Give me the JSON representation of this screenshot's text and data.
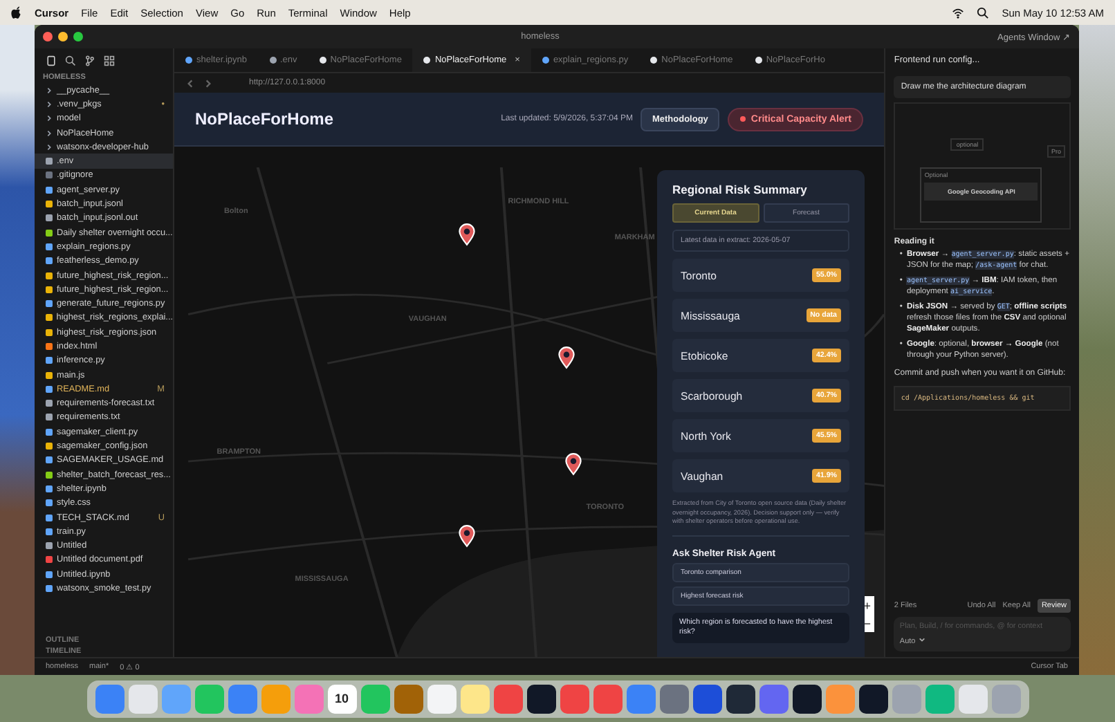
{
  "menu_bar": {
    "app": "Cursor",
    "items": [
      "File",
      "Edit",
      "Selection",
      "View",
      "Go",
      "Run",
      "Terminal",
      "Window",
      "Help"
    ],
    "clock": "Sun May 10  12:53 AM"
  },
  "window": {
    "title": "homeless",
    "agents_label": "Agents Window ↗"
  },
  "explorer": {
    "root": "HOMELESS",
    "items": [
      {
        "name": "__pycache__",
        "kind": "folder",
        "selected": false
      },
      {
        "name": ".venv_pkgs",
        "kind": "folder",
        "selected": false,
        "badge": "•"
      },
      {
        "name": "model",
        "kind": "folder",
        "selected": false
      },
      {
        "name": "NoPlaceHome",
        "kind": "folder",
        "selected": false
      },
      {
        "name": "watsonx-developer-hub",
        "kind": "folder",
        "selected": false
      },
      {
        "name": ".env",
        "kind": "env",
        "selected": true
      },
      {
        "name": ".gitignore",
        "kind": "git",
        "selected": false
      },
      {
        "name": "agent_server.py",
        "kind": "py",
        "selected": false
      },
      {
        "name": "batch_input.jsonl",
        "kind": "json",
        "selected": false
      },
      {
        "name": "batch_input.jsonl.out",
        "kind": "txt",
        "selected": false
      },
      {
        "name": "Daily shelter overnight occu...",
        "kind": "csv",
        "selected": false
      },
      {
        "name": "explain_regions.py",
        "kind": "py",
        "selected": false
      },
      {
        "name": "featherless_demo.py",
        "kind": "py",
        "selected": false
      },
      {
        "name": "future_highest_risk_region...",
        "kind": "json",
        "selected": false
      },
      {
        "name": "future_highest_risk_region...",
        "kind": "json",
        "selected": false
      },
      {
        "name": "generate_future_regions.py",
        "kind": "py",
        "selected": false
      },
      {
        "name": "highest_risk_regions_explai...",
        "kind": "json",
        "selected": false
      },
      {
        "name": "highest_risk_regions.json",
        "kind": "json",
        "selected": false
      },
      {
        "name": "index.html",
        "kind": "html",
        "selected": false
      },
      {
        "name": "inference.py",
        "kind": "py",
        "selected": false
      },
      {
        "name": "main.js",
        "kind": "js",
        "selected": false
      },
      {
        "name": "README.md",
        "kind": "md",
        "selected": false,
        "badge": "M"
      },
      {
        "name": "requirements-forecast.txt",
        "kind": "txt",
        "selected": false
      },
      {
        "name": "requirements.txt",
        "kind": "txt",
        "selected": false
      },
      {
        "name": "sagemaker_client.py",
        "kind": "py",
        "selected": false
      },
      {
        "name": "sagemaker_config.json",
        "kind": "json",
        "selected": false
      },
      {
        "name": "SAGEMAKER_USAGE.md",
        "kind": "md",
        "selected": false
      },
      {
        "name": "shelter_batch_forecast_res...",
        "kind": "csv",
        "selected": false
      },
      {
        "name": "shelter.ipynb",
        "kind": "ipynb",
        "selected": false
      },
      {
        "name": "style.css",
        "kind": "css",
        "selected": false
      },
      {
        "name": "TECH_STACK.md",
        "kind": "md",
        "selected": false,
        "badge": "U"
      },
      {
        "name": "train.py",
        "kind": "py",
        "selected": false
      },
      {
        "name": "Untitled",
        "kind": "txt",
        "selected": false
      },
      {
        "name": "Untitled document.pdf",
        "kind": "pdf",
        "selected": false
      },
      {
        "name": "Untitled.ipynb",
        "kind": "ipynb",
        "selected": false
      },
      {
        "name": "watsonx_smoke_test.py",
        "kind": "py",
        "selected": false
      }
    ],
    "sections": [
      "OUTLINE",
      "TIMELINE"
    ]
  },
  "tabs": [
    {
      "label": "shelter.ipynb",
      "kind": "ipynb",
      "selected": false
    },
    {
      "label": ".env",
      "kind": "env",
      "selected": false
    },
    {
      "label": "NoPlaceForHome",
      "kind": "web",
      "selected": false
    },
    {
      "label": "NoPlaceForHome",
      "kind": "web",
      "selected": true,
      "close": "×"
    },
    {
      "label": "explain_regions.py",
      "kind": "py",
      "selected": false
    },
    {
      "label": "NoPlaceForHome",
      "kind": "web",
      "selected": false
    },
    {
      "label": "NoPlaceForHo",
      "kind": "web",
      "selected": false
    }
  ],
  "browser": {
    "url": "http://127.0.0.1:8000"
  },
  "app": {
    "title": "NoPlaceForHome",
    "updated": "Last updated: 5/9/2026, 5:37:04 PM",
    "methodology": "Methodology",
    "alert": "Critical Capacity Alert",
    "map_labels": [
      "Bolton",
      "RICHMOND HILL",
      "MARKHAM",
      "VAUGHAN",
      "BRAMPTON",
      "TORONTO",
      "MISSISSAUGA"
    ],
    "zoom": [
      "+",
      "−"
    ],
    "summary": {
      "title": "Regional Risk Summary",
      "modes": [
        {
          "label": "Current Data",
          "selected": true
        },
        {
          "label": "Forecast",
          "selected": false
        }
      ],
      "extract": "Latest data in extract: 2026-05-07",
      "regions": [
        {
          "name": "Toronto",
          "value": "55.0%"
        },
        {
          "name": "Mississauga",
          "value": "No data"
        },
        {
          "name": "Etobicoke",
          "value": "42.4%"
        },
        {
          "name": "Scarborough",
          "value": "40.7%"
        },
        {
          "name": "North York",
          "value": "45.5%"
        },
        {
          "name": "Vaughan",
          "value": "41.9%"
        }
      ],
      "note": "Extracted from City of Toronto open source data (Daily shelter overnight occupancy, 2026). Decision support only — verify with shelter operators before operational use.",
      "agent_title": "Ask Shelter Risk Agent",
      "suggestions": [
        "Toronto comparison",
        "Highest forecast risk"
      ],
      "question": "Which region is forecasted to have the highest risk?"
    }
  },
  "chat": {
    "tab": "Frontend run config...",
    "prompt": "Draw me the architecture diagram",
    "diagram": {
      "note": "optional",
      "group": "Optional",
      "box": "Google Geocoding API",
      "side": "Pro"
    },
    "heading": "Reading it",
    "marker": "•",
    "bullets": [
      [
        {
          "kind": "bold",
          "t": "Browser"
        },
        {
          "kind": "text",
          "t": " → "
        },
        {
          "kind": "code",
          "t": "agent_server.py"
        },
        {
          "kind": "text",
          "t": ": static assets + JSON for the map; "
        },
        {
          "kind": "code",
          "t": "/ask-agent"
        },
        {
          "kind": "text",
          "t": " for chat."
        }
      ],
      [
        {
          "kind": "code",
          "t": "agent_server.py"
        },
        {
          "kind": "text",
          "t": " → "
        },
        {
          "kind": "bold",
          "t": "IBM"
        },
        {
          "kind": "text",
          "t": ": IAM token, then deployment "
        },
        {
          "kind": "code",
          "t": "ai_service"
        },
        {
          "kind": "text",
          "t": "."
        }
      ],
      [
        {
          "kind": "bold",
          "t": "Disk JSON"
        },
        {
          "kind": "text",
          "t": " → served by "
        },
        {
          "kind": "code",
          "t": "GET"
        },
        {
          "kind": "text",
          "t": "; "
        },
        {
          "kind": "bold",
          "t": "offline scripts"
        },
        {
          "kind": "text",
          "t": " refresh those files from the "
        },
        {
          "kind": "bold",
          "t": "CSV"
        },
        {
          "kind": "text",
          "t": " and optional "
        },
        {
          "kind": "bold",
          "t": "SageMaker"
        },
        {
          "kind": "text",
          "t": " outputs."
        }
      ],
      [
        {
          "kind": "bold",
          "t": "Google"
        },
        {
          "kind": "text",
          "t": ": optional, "
        },
        {
          "kind": "bold",
          "t": "browser → Google"
        },
        {
          "kind": "text",
          "t": " (not through your Python server)."
        }
      ]
    ],
    "closing": "Commit and push when you want it on GitHub:",
    "code": "cd /Applications/homeless && git",
    "files": "2 Files",
    "undo": "Undo All",
    "keep": "Keep All",
    "review": "Review",
    "placeholder": "Plan, Build, / for commands, @ for context",
    "mode": "Auto"
  },
  "status_bar": {
    "branch": "main*",
    "folder": "homeless",
    "problems": "0 ⚠ 0",
    "right": "Cursor Tab"
  },
  "dock": [
    {
      "color": "#3b82f6"
    },
    {
      "color": "#e5e7eb"
    },
    {
      "color": "#60a5fa"
    },
    {
      "color": "#22c55e"
    },
    {
      "color": "#3b82f6"
    },
    {
      "color": "#f59e0b"
    },
    {
      "color": "#f472b6"
    },
    {
      "color": "#ffffff",
      "label": "10"
    },
    {
      "color": "#22c55e"
    },
    {
      "color": "#a16207"
    },
    {
      "color": "#f3f4f6"
    },
    {
      "color": "#fde68a"
    },
    {
      "color": "#ef4444"
    },
    {
      "color": "#111827"
    },
    {
      "color": "#ef4444"
    },
    {
      "color": "#ef4444"
    },
    {
      "color": "#3b82f6"
    },
    {
      "color": "#6b7280"
    },
    {
      "color": "#1d4ed8"
    },
    {
      "color": "#1f2937"
    },
    {
      "color": "#6366f1"
    },
    {
      "color": "#111827"
    },
    {
      "color": "#fb923c"
    },
    {
      "color": "#111827"
    },
    {
      "color": "#9ca3af"
    },
    {
      "color": "#10b981"
    },
    {
      "color": "#e5e7eb"
    },
    {
      "color": "#9ca3af"
    }
  ]
}
